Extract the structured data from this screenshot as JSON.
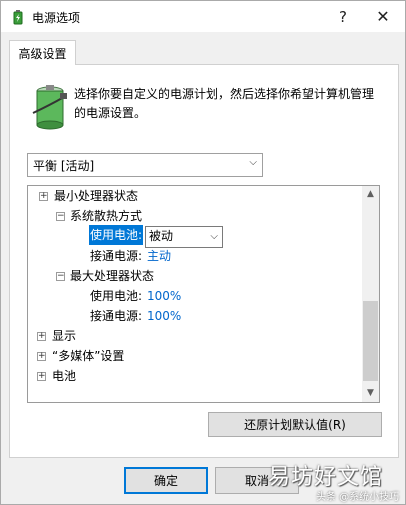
{
  "window": {
    "title": "电源选项",
    "help_glyph": "?",
    "close_glyph": "✕"
  },
  "tab": {
    "label": "高级设置"
  },
  "intro": {
    "text": "选择你要自定义的电源计划，然后选择你希望计算机管理的电源设置。"
  },
  "plan_select": {
    "value": "平衡 [活动]",
    "arrow": "⌵"
  },
  "tree": {
    "min_processor": {
      "toggle": "+",
      "label": "最小处理器状态"
    },
    "cooling": {
      "toggle": "−",
      "label": "系统散热方式",
      "battery_label": "使用电池:",
      "battery_value": "被动",
      "plugged_label": "接通电源:",
      "plugged_value": "主动"
    },
    "max_processor": {
      "toggle": "−",
      "label": "最大处理器状态",
      "battery_label": "使用电池:",
      "battery_value": "100%",
      "plugged_label": "接通电源:",
      "plugged_value": "100%"
    },
    "display": {
      "toggle": "+",
      "label": "显示"
    },
    "multimedia": {
      "toggle": "+",
      "label": "“多媒体”设置"
    },
    "battery": {
      "toggle": "+",
      "label": "电池"
    },
    "scroll_up": "▲",
    "scroll_down": "▼"
  },
  "buttons": {
    "restore": "还原计划默认值(R)",
    "ok": "确定",
    "cancel": "取消"
  },
  "watermark": {
    "main": "易坊好文馆",
    "sub": "头条 @系统小技巧"
  },
  "colors": {
    "selection": "#0078d7",
    "link_value": "#0066cc",
    "accent_border": "#0078d7"
  }
}
